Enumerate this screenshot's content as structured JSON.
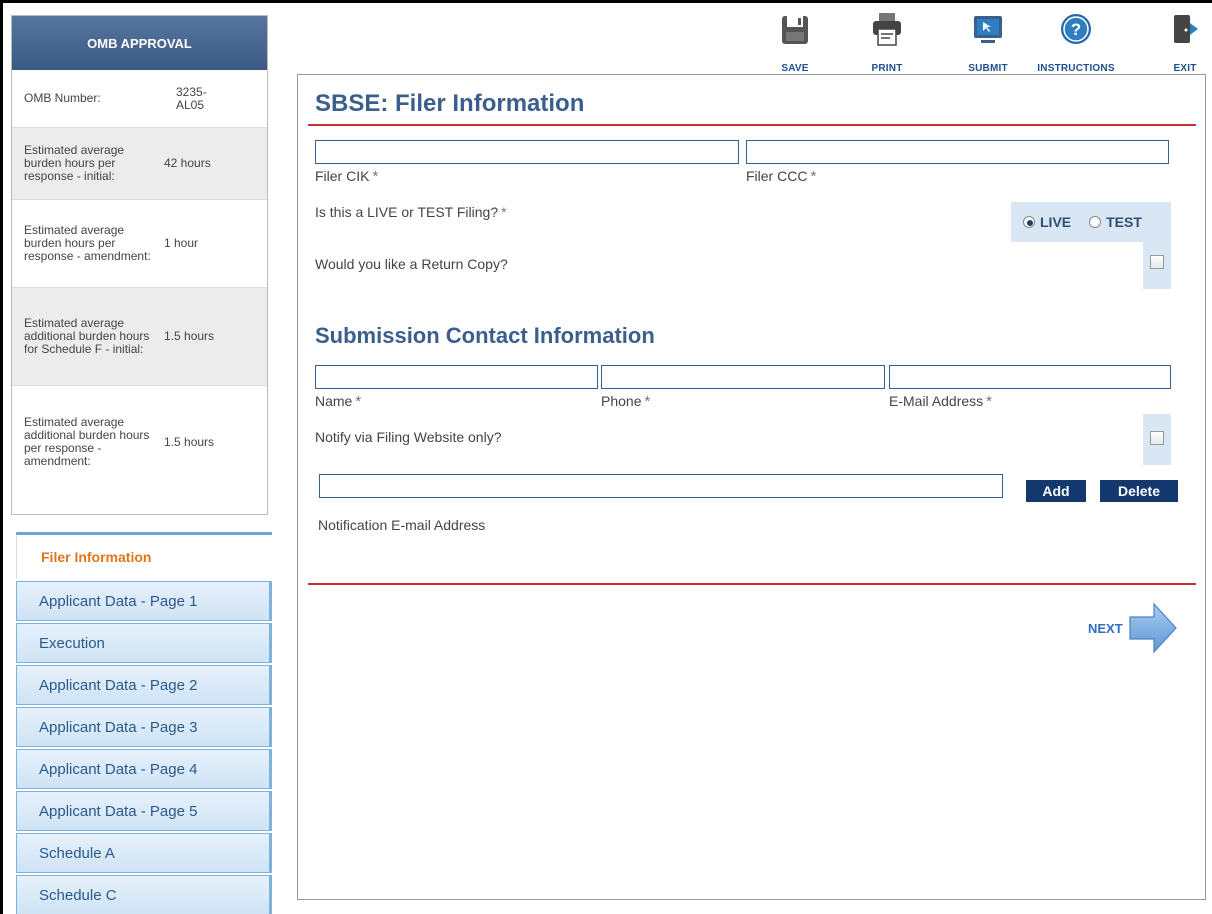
{
  "omb": {
    "title": "OMB APPROVAL",
    "rows": [
      {
        "label": "OMB Number:",
        "value": "3235-AL05"
      },
      {
        "label": "Estimated average burden hours per response - initial:",
        "value": "42 hours"
      },
      {
        "label": "Estimated average burden hours per response - amendment:",
        "value": "1 hour"
      },
      {
        "label": "Estimated average additional burden hours for Schedule F - initial:",
        "value": "1.5 hours"
      },
      {
        "label": "Estimated average additional burden hours per response - amendment:",
        "value": "1.5 hours"
      }
    ]
  },
  "nav": {
    "items": [
      {
        "label": "Filer Information",
        "active": true
      },
      {
        "label": "Applicant Data - Page 1"
      },
      {
        "label": "Execution"
      },
      {
        "label": "Applicant Data - Page 2"
      },
      {
        "label": "Applicant Data - Page 3"
      },
      {
        "label": "Applicant Data - Page 4"
      },
      {
        "label": "Applicant Data - Page 5"
      },
      {
        "label": "Schedule A"
      },
      {
        "label": "Schedule C"
      }
    ]
  },
  "toolbar": {
    "save": "SAVE",
    "print": "PRINT",
    "submit": "SUBMIT",
    "instructions": "INSTRUCTIONS",
    "exit": "EXIT"
  },
  "form": {
    "title": "SBSE: Filer Information",
    "filer_cik_label": "Filer CIK",
    "filer_ccc_label": "Filer CCC",
    "required_mark": "*",
    "live_test_question": "Is this a LIVE or TEST Filing?",
    "live_label": "LIVE",
    "test_label": "TEST",
    "selected_mode": "LIVE",
    "return_copy_question": "Would you like a Return Copy?",
    "contact_heading": "Submission Contact Information",
    "name_label": "Name",
    "phone_label": "Phone",
    "email_label": "E-Mail Address",
    "notify_question": "Notify via Filing Website only?",
    "add_button": "Add",
    "delete_button": "Delete",
    "notification_email_label": "Notification E-mail Address",
    "next_label": "NEXT"
  },
  "colors": {
    "heading": "#3a5f8d",
    "divider": "#c83232",
    "nav_active": "#e0751c",
    "button": "#12386e"
  }
}
